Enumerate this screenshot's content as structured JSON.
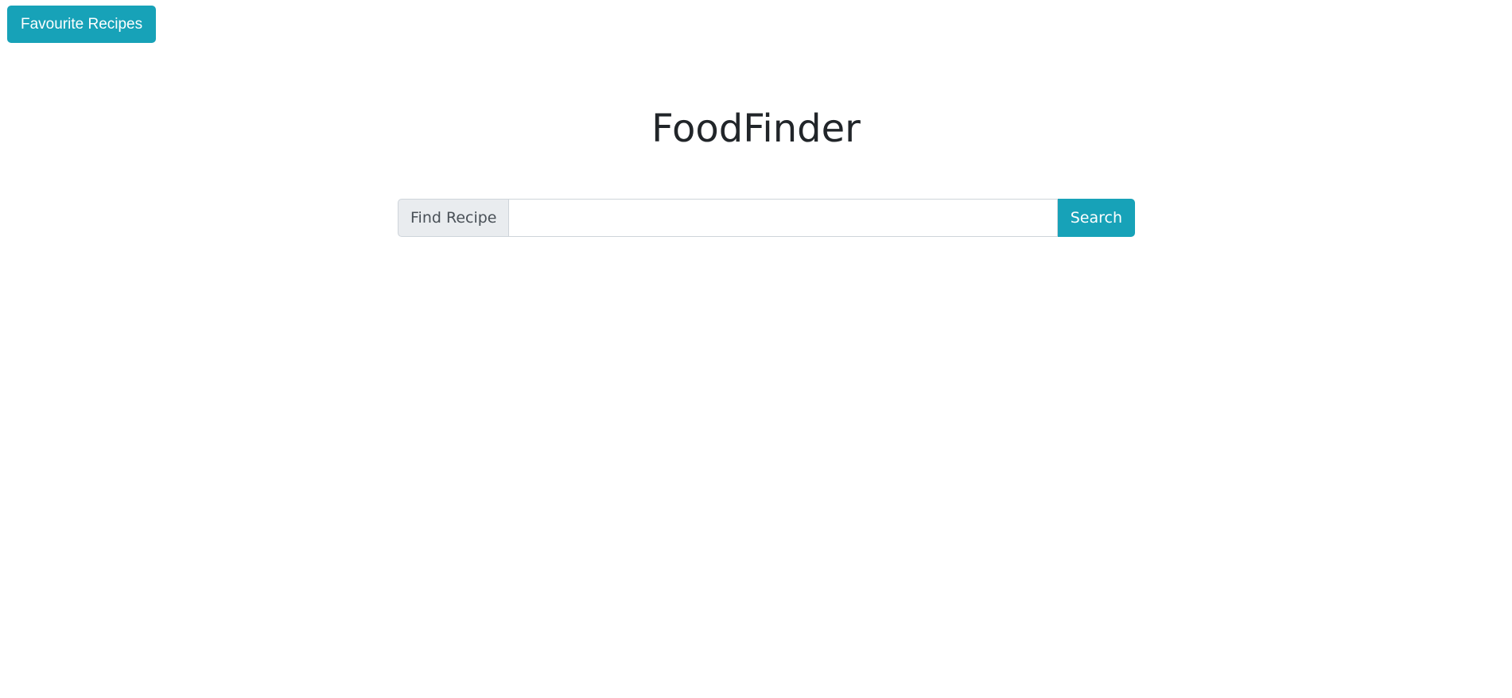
{
  "header": {
    "favourites_label": "Favourite Recipes"
  },
  "main": {
    "title": "FoodFinder",
    "search": {
      "prepend_label": "Find Recipe",
      "value": "",
      "placeholder": "",
      "button_label": "Search"
    }
  },
  "colors": {
    "accent": "#17a2b8",
    "addon_background": "#e9ecef",
    "border": "#ced4da",
    "text": "#212529"
  }
}
